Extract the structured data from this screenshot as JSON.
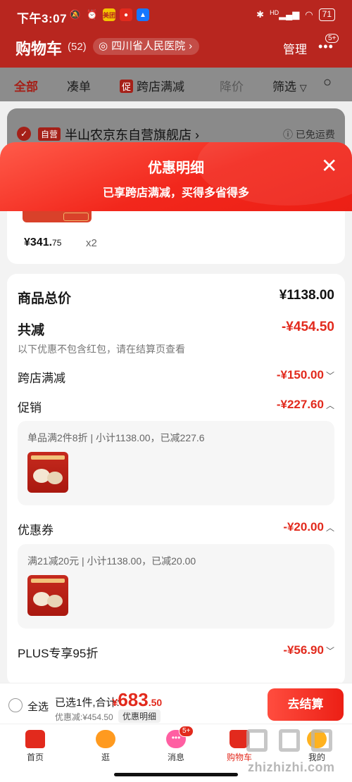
{
  "status_bar": {
    "time": "下午3:07",
    "network": "HD",
    "battery": "71"
  },
  "header": {
    "title": "购物车",
    "count": "(52)",
    "address": "四川省人民医院",
    "manage": "管理",
    "more_badge": "5+"
  },
  "tabs": [
    {
      "label": "全部"
    },
    {
      "label": "凑单"
    },
    {
      "label": "跨店满减",
      "chip": "促"
    },
    {
      "label": "降价"
    },
    {
      "label": "筛选"
    }
  ],
  "store": {
    "self_tag": "自营",
    "name": "半山农京东自营旗舰店",
    "shipping": "已免运费"
  },
  "popup": {
    "title": "优惠明细",
    "subtitle": "已享跨店满减，买得多省得多"
  },
  "item": {
    "price_main": "¥341.",
    "price_dec": "75",
    "quantity": "x2"
  },
  "details": {
    "total_label": "商品总价",
    "total_value": "¥1138.00",
    "discount_label": "共减",
    "discount_value": "-¥454.50",
    "note": "以下优惠不包含红包，请在结算页查看",
    "cross_store_label": "跨店满减",
    "cross_store_value": "-¥150.00",
    "promo_label": "促销",
    "promo_value": "-¥227.60",
    "promo_desc": "单品满2件8折 | 小计1138.00，已减227.6",
    "coupon_label": "优惠券",
    "coupon_value": "-¥20.00",
    "coupon_desc": "满21减20元 | 小计1138.00，已减20.00",
    "plus_label": "PLUS专享95折",
    "plus_value": "-¥56.90"
  },
  "checkout": {
    "select_all": "全选",
    "selected": "已选1件,合计:",
    "price_symbol": "¥",
    "price_int": "683",
    "price_dec": ".50",
    "discount": "优惠减:¥454.50",
    "detail_toggle": "优惠明细",
    "button": "去结算"
  },
  "nav": [
    {
      "label": "首页",
      "icon": "home-icon"
    },
    {
      "label": "逛",
      "icon": "browse-icon"
    },
    {
      "label": "消息",
      "icon": "message-icon",
      "badge": "5+"
    },
    {
      "label": "购物车",
      "icon": "cart-icon"
    },
    {
      "label": "我的",
      "icon": "profile-icon"
    }
  ],
  "watermark": "zhizhizhi.com",
  "colors": {
    "brand_red": "#e22a1d",
    "header_red": "#b8261f"
  }
}
